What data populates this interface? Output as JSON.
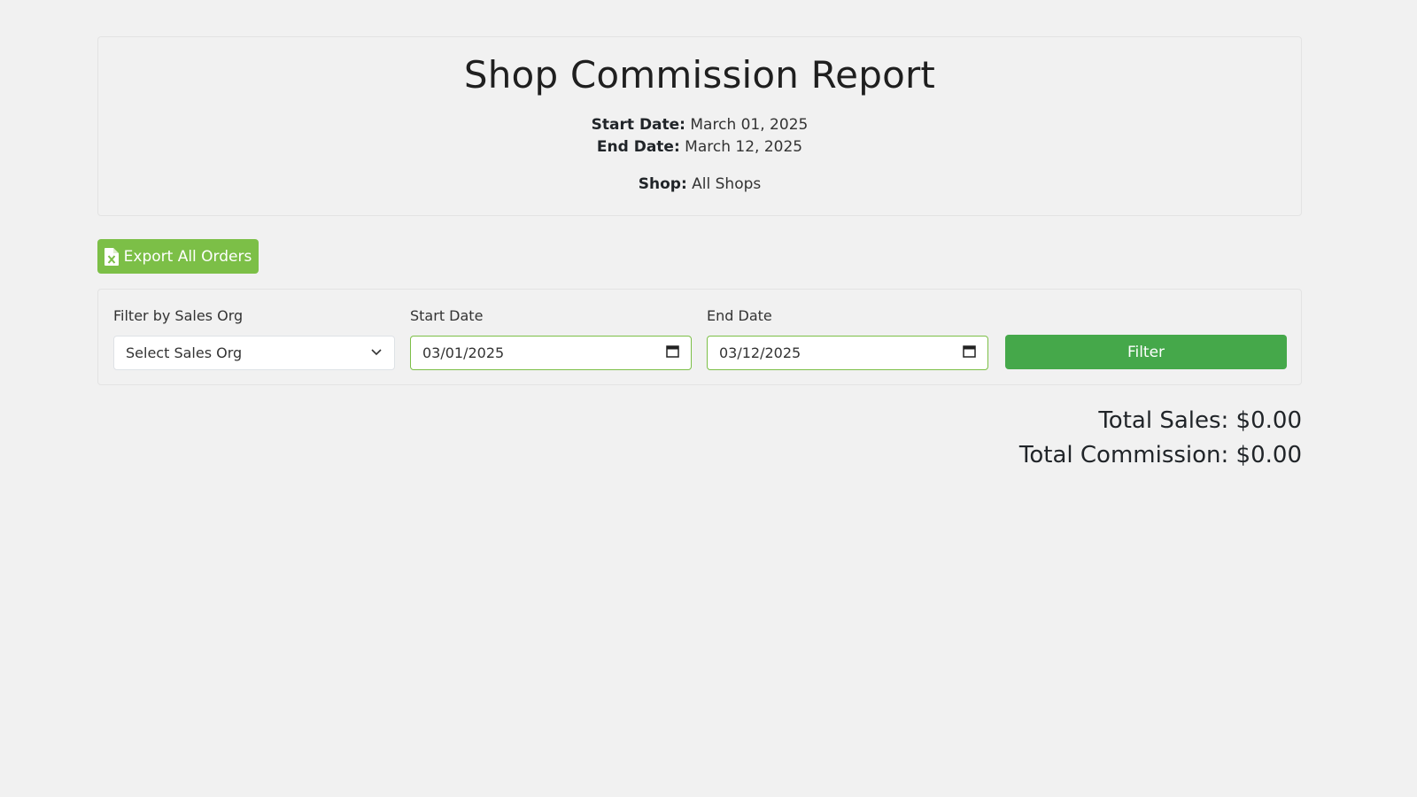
{
  "report": {
    "title": "Shop Commission Report",
    "start_label": "Start Date:",
    "start_value": "March 01, 2025",
    "end_label": "End Date:",
    "end_value": "March 12, 2025",
    "shop_label": "Shop:",
    "shop_value": "All Shops"
  },
  "actions": {
    "export_label": "Export All Orders",
    "export_icon": "excel-file-icon"
  },
  "filters": {
    "sales_org_label": "Filter by Sales Org",
    "sales_org_value": "Select Sales Org",
    "start_label": "Start Date",
    "start_value": "03/01/2025",
    "end_label": "End Date",
    "end_value": "03/12/2025",
    "filter_button": "Filter"
  },
  "totals": {
    "sales": "Total Sales: $0.00",
    "commission": "Total Commission: $0.00"
  },
  "colors": {
    "export_button": "#7cbf47",
    "filter_button": "#45a84a",
    "background": "#f1f1f1"
  }
}
